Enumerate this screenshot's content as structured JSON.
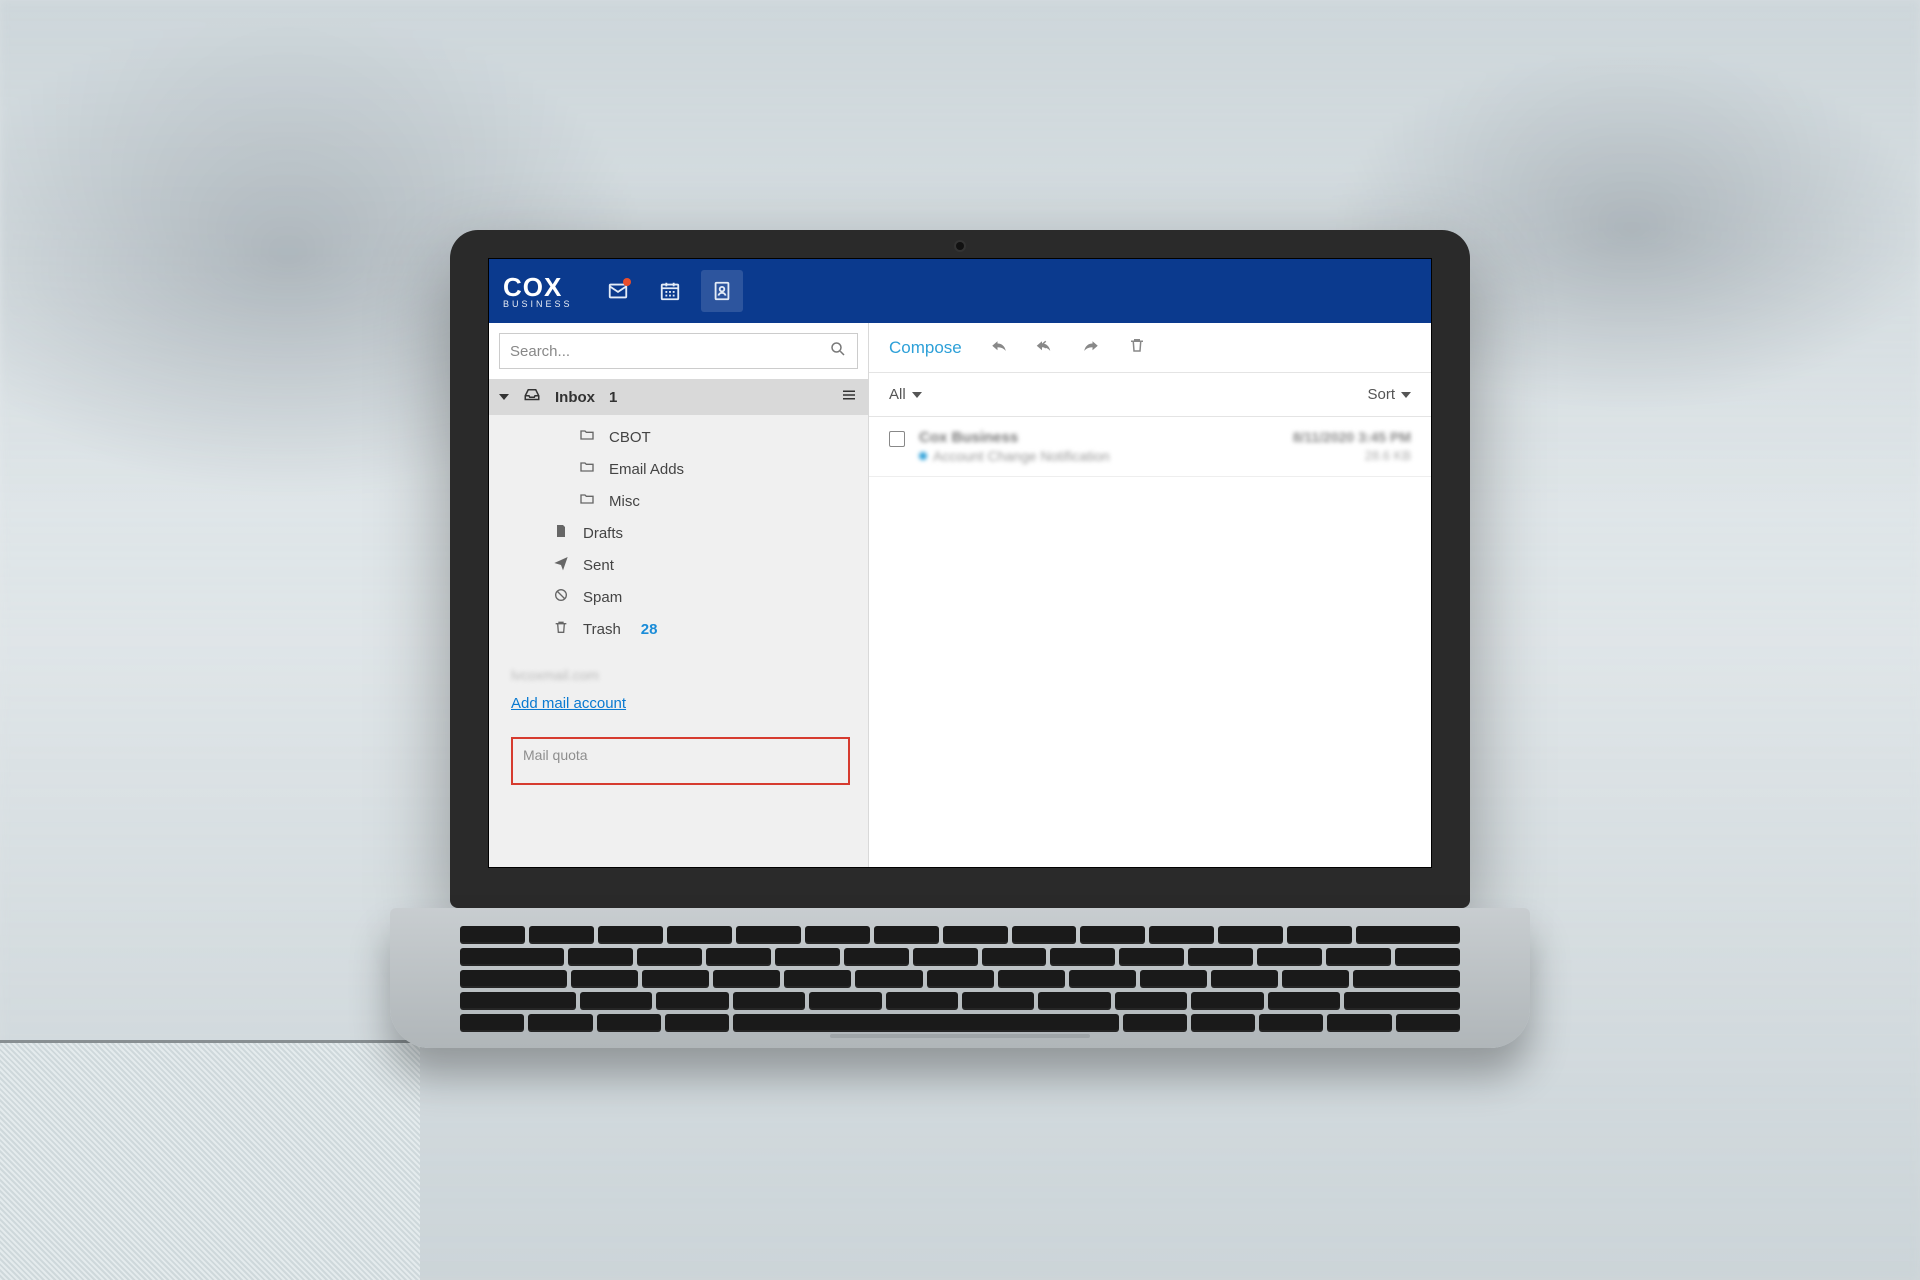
{
  "brand": {
    "name": "COX",
    "sub": "BUSINESS"
  },
  "nav": {
    "mail": "mail",
    "calendar": "calendar",
    "contacts": "contacts"
  },
  "search": {
    "placeholder": "Search..."
  },
  "folders": {
    "inbox_label": "Inbox",
    "inbox_count": "1",
    "subs": [
      {
        "label": "CBOT"
      },
      {
        "label": "Email Adds"
      },
      {
        "label": "Misc"
      }
    ],
    "drafts": "Drafts",
    "sent": "Sent",
    "spam": "Spam",
    "trash": "Trash",
    "trash_count": "28"
  },
  "account_hint": "lvcoxmail.com",
  "add_account": "Add mail account",
  "quota_label": "Mail quota",
  "toolbar": {
    "compose": "Compose",
    "all": "All",
    "sort": "Sort"
  },
  "message": {
    "sender": "Cox Business",
    "date": "8/11/2020 3:45 PM",
    "subject": "Account Change Notification",
    "size": "28.6 KB"
  }
}
